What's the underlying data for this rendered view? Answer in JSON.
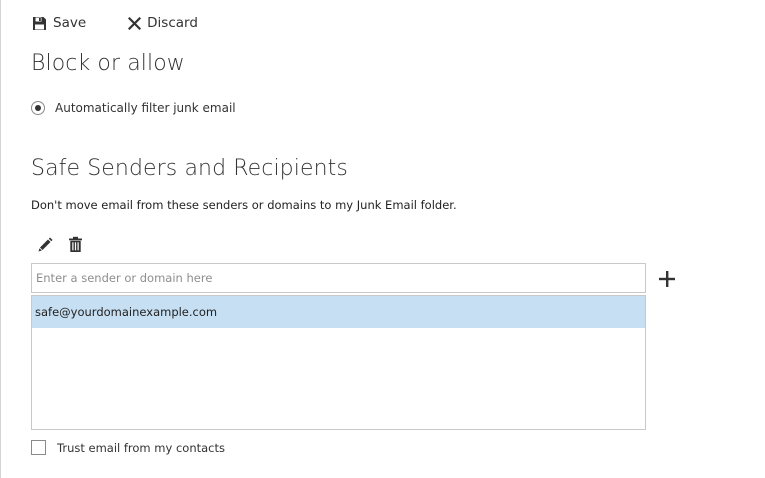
{
  "toolbar": {
    "save_label": "Save",
    "discard_label": "Discard",
    "save_icon": "floppy-disk-icon",
    "discard_icon": "x-icon"
  },
  "block_section": {
    "title": "Block or allow",
    "option_label": "Automatically filter junk email",
    "option_selected": true
  },
  "safe_section": {
    "title": "Safe Senders and Recipients",
    "description": "Don't move email from these senders or domains to my Junk Email folder.",
    "edit_icon": "pencil-icon",
    "delete_icon": "trash-icon",
    "input": {
      "placeholder": "Enter a sender or domain here",
      "value": ""
    },
    "add_icon": "plus-icon",
    "entries": [
      {
        "text": "safe@yourdomainexample.com",
        "selected": true
      }
    ],
    "trust_contacts": {
      "label": "Trust email from my contacts",
      "checked": false
    }
  },
  "colors": {
    "text": "#333333",
    "selection": "#c7dff2",
    "border": "#c8c8c8"
  }
}
